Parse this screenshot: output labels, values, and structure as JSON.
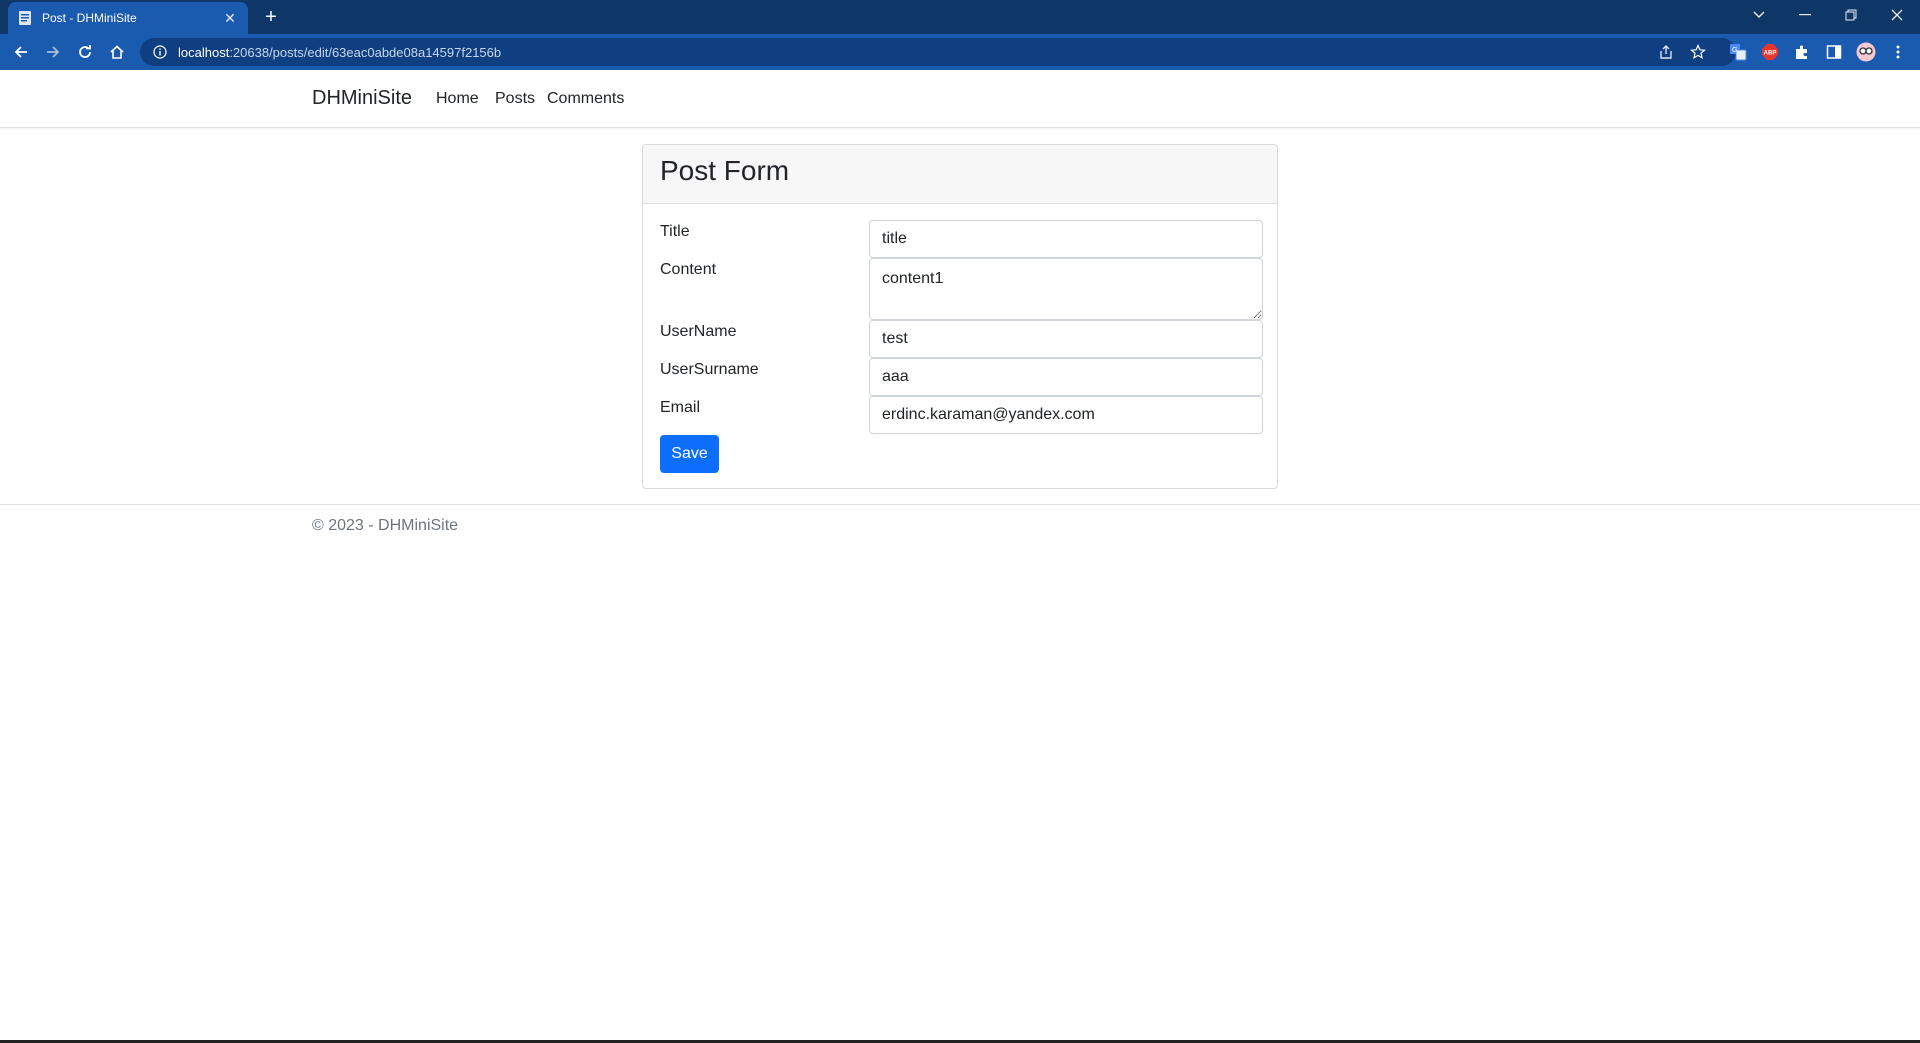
{
  "browser": {
    "tab_title": "Post - DHMiniSite",
    "url_host": "localhost",
    "url_path": ":20638/posts/edit/63eac0abde08a14597f2156b",
    "ext_abp": "ABP"
  },
  "site": {
    "brand": "DHMiniSite",
    "nav": {
      "home": "Home",
      "posts": "Posts",
      "comments": "Comments"
    }
  },
  "form": {
    "heading": "Post Form",
    "fields": {
      "title": {
        "label": "Title",
        "value": "title"
      },
      "content": {
        "label": "Content",
        "value": "content1"
      },
      "username": {
        "label": "UserName",
        "value": "test"
      },
      "usersurname": {
        "label": "UserSurname",
        "value": "aaa"
      },
      "email": {
        "label": "Email",
        "value": "erdinc.karaman@yandex.com"
      }
    },
    "save_label": "Save"
  },
  "footer": {
    "text": "© 2023 - DHMiniSite"
  },
  "colors": {
    "chrome_dark": "#0e3768",
    "chrome_active": "#1a5bb0",
    "primary": "#0d6efd"
  }
}
